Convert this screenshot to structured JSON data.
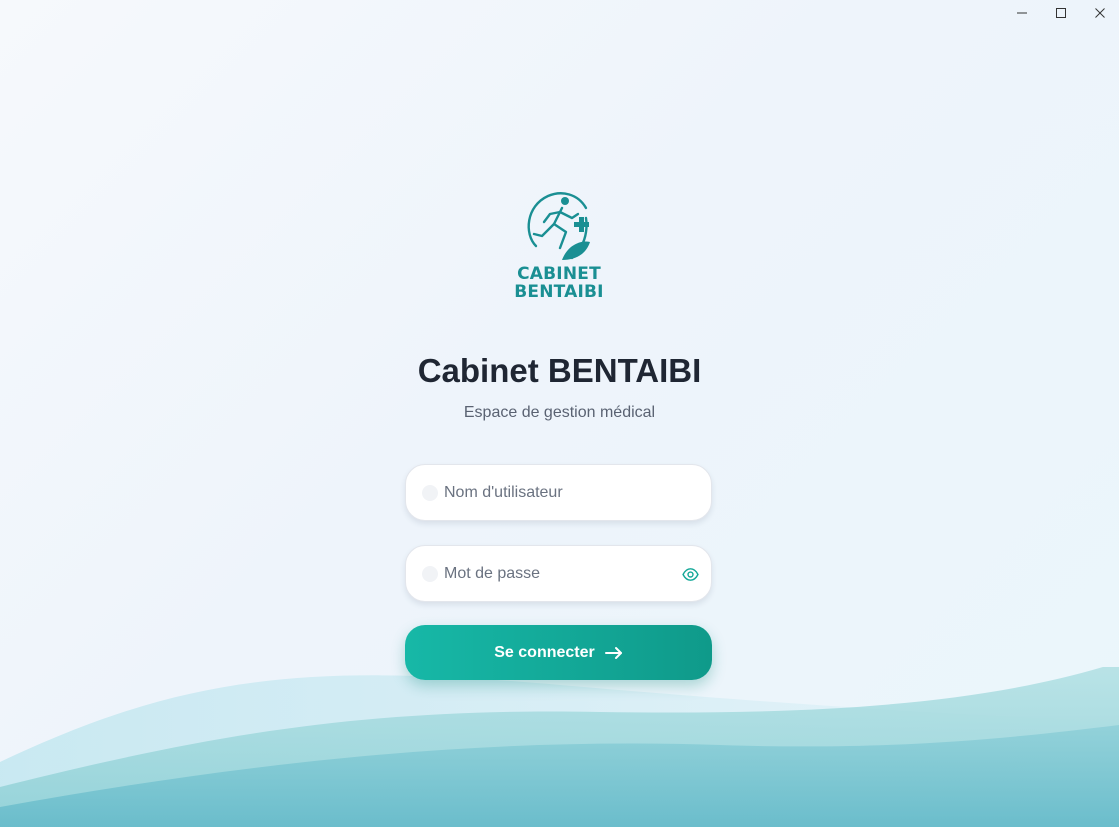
{
  "window": {
    "controls": {
      "minimize": "minimize-icon",
      "maximize": "maximize-icon",
      "close": "close-icon"
    }
  },
  "logo": {
    "line1": "CABINET",
    "line2": "BENTAIBI",
    "icon": "runner-medical-cross-leaf-logo",
    "color": "#1a8f93"
  },
  "header": {
    "title": "Cabinet BENTAIBI",
    "subtitle": "Espace de gestion médical"
  },
  "form": {
    "username": {
      "placeholder": "Nom d'utilisateur",
      "value": ""
    },
    "password": {
      "placeholder": "Mot de passe",
      "value": "",
      "toggle_icon": "eye-icon"
    },
    "submit": {
      "label": "Se connecter",
      "icon": "arrow-right-icon"
    }
  },
  "colors": {
    "accent": "#14a898",
    "title": "#1f2633",
    "subtitle": "#5a6272",
    "wave": "#8fd0d6"
  }
}
